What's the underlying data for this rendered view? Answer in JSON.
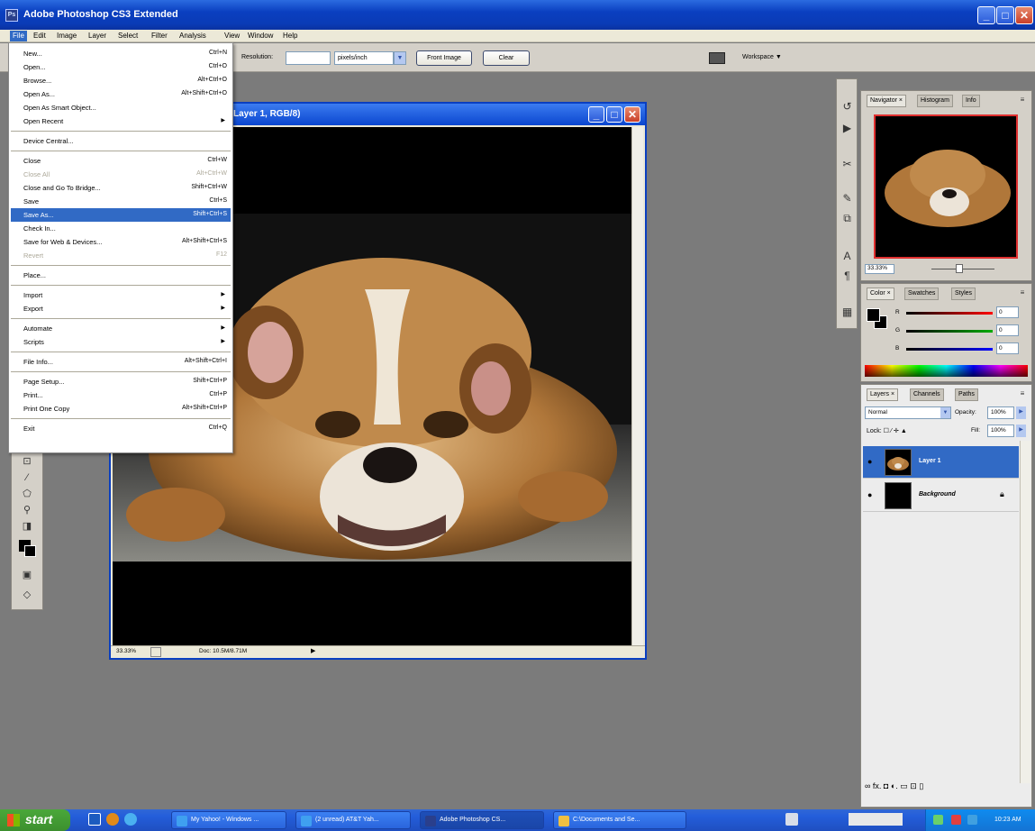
{
  "window": {
    "title": "Adobe Photoshop CS3 Extended",
    "logo_text": "Ps",
    "minimize_glyph": "_",
    "maximize_glyph": "□",
    "close_glyph": "✕"
  },
  "menubar": [
    "File",
    "Edit",
    "Image",
    "Layer",
    "Select",
    "Filter",
    "Analysis",
    "View",
    "Window",
    "Help"
  ],
  "options_bar": {
    "resolution_label": "Resolution:",
    "resolution_value": "",
    "units": "pixels/inch",
    "front_image_button": "Front Image",
    "clear_button": "Clear",
    "workspace_label": "Workspace ▼"
  },
  "file_menu": {
    "items": [
      {
        "label": "New...",
        "shortcut": "Ctrl+N",
        "state": "enabled",
        "submenu": false
      },
      {
        "label": "Open...",
        "shortcut": "Ctrl+O",
        "state": "enabled",
        "submenu": false
      },
      {
        "label": "Browse...",
        "shortcut": "Alt+Ctrl+O",
        "state": "enabled",
        "submenu": false
      },
      {
        "label": "Open As...",
        "shortcut": "Alt+Shift+Ctrl+O",
        "state": "enabled",
        "submenu": false
      },
      {
        "label": "Open As Smart Object...",
        "shortcut": "",
        "state": "enabled",
        "submenu": false
      },
      {
        "label": "Open Recent",
        "shortcut": "",
        "state": "enabled",
        "submenu": true
      },
      {
        "label": "Device Central...",
        "shortcut": "",
        "state": "enabled",
        "submenu": false
      },
      {
        "label": "Close",
        "shortcut": "Ctrl+W",
        "state": "enabled",
        "submenu": false
      },
      {
        "label": "Close All",
        "shortcut": "Alt+Ctrl+W",
        "state": "disabled",
        "submenu": false
      },
      {
        "label": "Close and Go To Bridge...",
        "shortcut": "Shift+Ctrl+W",
        "state": "enabled",
        "submenu": false
      },
      {
        "label": "Save",
        "shortcut": "Ctrl+S",
        "state": "enabled",
        "submenu": false
      },
      {
        "label": "Save As...",
        "shortcut": "Shift+Ctrl+S",
        "state": "highlighted",
        "submenu": false
      },
      {
        "label": "Check In...",
        "shortcut": "",
        "state": "enabled",
        "submenu": false
      },
      {
        "label": "Save for Web & Devices...",
        "shortcut": "Alt+Shift+Ctrl+S",
        "state": "enabled",
        "submenu": false
      },
      {
        "label": "Revert",
        "shortcut": "F12",
        "state": "disabled",
        "submenu": false
      },
      {
        "label": "Place...",
        "shortcut": "",
        "state": "enabled",
        "submenu": false
      },
      {
        "label": "Import",
        "shortcut": "",
        "state": "enabled",
        "submenu": true
      },
      {
        "label": "Export",
        "shortcut": "",
        "state": "enabled",
        "submenu": true
      },
      {
        "label": "Automate",
        "shortcut": "",
        "state": "enabled",
        "submenu": true
      },
      {
        "label": "Scripts",
        "shortcut": "",
        "state": "enabled",
        "submenu": true
      },
      {
        "label": "File Info...",
        "shortcut": "Alt+Shift+Ctrl+I",
        "state": "enabled",
        "submenu": false
      },
      {
        "label": "Page Setup...",
        "shortcut": "Shift+Ctrl+P",
        "state": "enabled",
        "submenu": false
      },
      {
        "label": "Print...",
        "shortcut": "Ctrl+P",
        "state": "enabled",
        "submenu": false
      },
      {
        "label": "Print One Copy",
        "shortcut": "Alt+Shift+Ctrl+P",
        "state": "enabled",
        "submenu": false
      },
      {
        "label": "Exit",
        "shortcut": "Ctrl+Q",
        "state": "enabled",
        "submenu": false
      }
    ]
  },
  "document": {
    "title": "Layer 1, RGB/8)",
    "zoom": "33.33%",
    "doc_size": "Doc: 10.5M/8.71M"
  },
  "navigator_panel": {
    "tabs": [
      "Navigator ×",
      "Histogram",
      "Info"
    ],
    "zoom": "33.33%"
  },
  "color_panel": {
    "tabs": [
      "Color ×",
      "Swatches",
      "Styles"
    ],
    "channels": [
      {
        "name": "R",
        "value": "0",
        "color": "#ff0000"
      },
      {
        "name": "G",
        "value": "0",
        "color": "#00aa00"
      },
      {
        "name": "B",
        "value": "0",
        "color": "#0000ff"
      }
    ]
  },
  "layers_panel": {
    "tabs": [
      "Layers ×",
      "Channels",
      "Paths"
    ],
    "blend_mode": "Normal",
    "opacity_label": "Opacity:",
    "opacity": "100%",
    "lock_label": "Lock: ☐ ⁄ ✛ ▲",
    "fill_label": "Fill:",
    "fill": "100%",
    "layers": [
      {
        "name": "Layer 1",
        "selected": true
      },
      {
        "name": "Background",
        "selected": false
      }
    ],
    "footer_icons": "∞  fx.  ◘  ◐.  ▭  ⊡  ▯"
  },
  "taskbar": {
    "start": "start",
    "tasks": [
      {
        "label": "My Yahoo! - Windows ...",
        "active": false
      },
      {
        "label": "(2 unread) AT&T Yah...",
        "active": false
      },
      {
        "label": "Adobe Photoshop CS...",
        "active": true
      },
      {
        "label": "C:\\Documents and Se...",
        "active": false
      }
    ],
    "clock": "10:23 AM"
  },
  "colors": {
    "title_blue": "#0a3fc0",
    "menu_highlight": "#316ac5",
    "workspace_gray": "#7b7b7b",
    "taskbar_blue": "#245edb",
    "start_green": "#3c8f2e"
  }
}
